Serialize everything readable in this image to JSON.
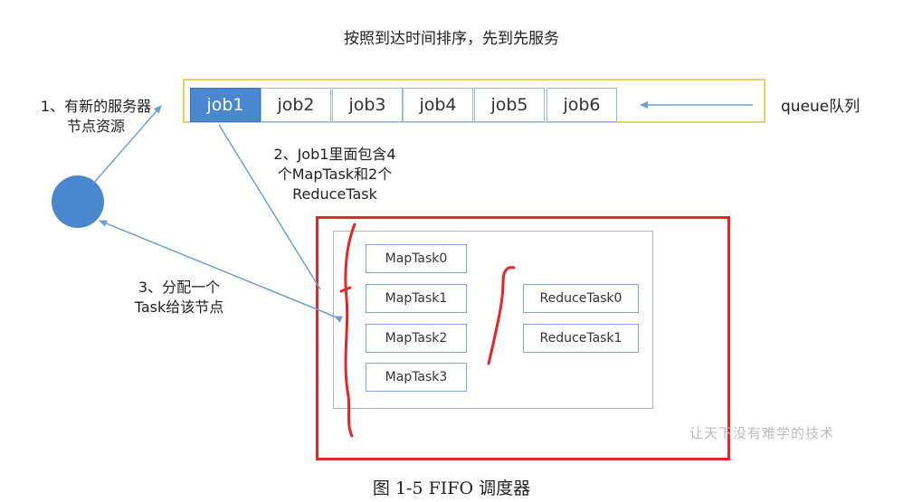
{
  "title": "按照到达时间排序，先到先服务",
  "queue": {
    "label": "queue队列",
    "jobs": [
      "job1",
      "job2",
      "job3",
      "job4",
      "job5",
      "job6"
    ]
  },
  "annotations": {
    "step1": [
      "1、有新的服务器",
      "节点资源"
    ],
    "step2": [
      "2、Job1里面包含4",
      "个MapTask和2个",
      "ReduceTask"
    ],
    "step3": [
      "3、分配一个",
      "Task给该节点"
    ]
  },
  "map_tasks": [
    "MapTask0",
    "MapTask1",
    "MapTask2",
    "MapTask3"
  ],
  "reduce_tasks": [
    "ReduceTask0",
    "ReduceTask1"
  ],
  "watermark": "让天下没有难学的技术",
  "caption": "图 1-5 FIFO 调度器",
  "colors": {
    "job_active": "#4a87cf",
    "queue_border": "#f2cc62",
    "arrow": "#6f9fd6",
    "red_mark": "#e62626"
  }
}
